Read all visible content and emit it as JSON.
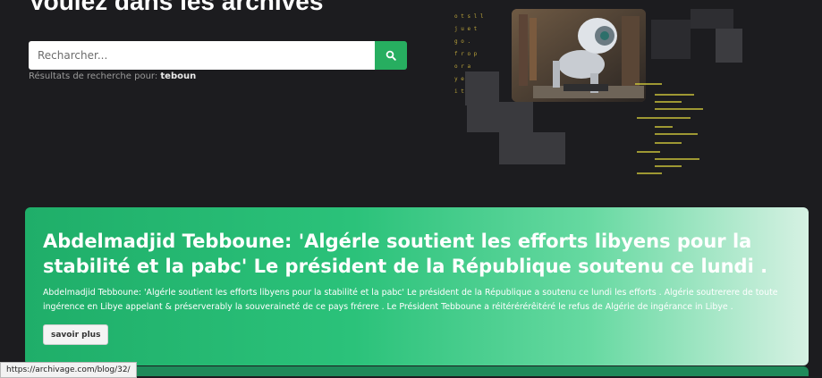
{
  "hero": {
    "title": "Voulez dans les archives"
  },
  "search": {
    "placeholder": "Recharcher...",
    "button_icon": "search-icon"
  },
  "results": {
    "prefix": "Résultats de recherche pour:",
    "query": "teboun"
  },
  "article": {
    "title": "Abdelmadjid Tebboune: 'Algérle soutient les efforts libyens pour la stabilité et la pabc' Le président de la République soutenu ce lundi .",
    "body": "Abdelmadjid Tebboune: 'Algérle soutient les efforts libyens pour la stabilité et la pabc' Le président de la République a soutenu ce lundi les efforts . Algérie soutrerere de toute ingérence en Libye appelant & préserverably la souveraineté de ce pays frérere . Le Président Tebboune a réitérérérêitéré le refus de Algérie de ingérance in Libye .",
    "read_more_label": "savoir plus"
  },
  "status_bar": {
    "url": "https://archivage.com/blog/32/"
  },
  "colors": {
    "background": "#1c1c1f",
    "accent": "#27ae60",
    "card_gradient_start": "#1fae69",
    "card_gradient_end": "#d6f1e3"
  }
}
